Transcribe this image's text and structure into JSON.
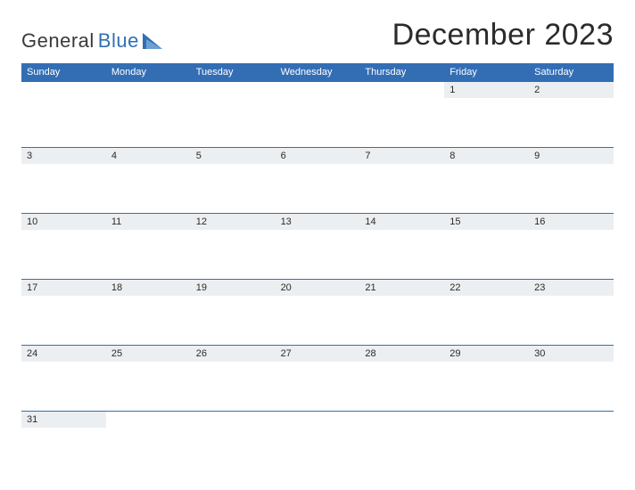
{
  "brand": {
    "part1": "General",
    "part2": "Blue"
  },
  "title": "December 2023",
  "day_names": [
    "Sunday",
    "Monday",
    "Tuesday",
    "Wednesday",
    "Thursday",
    "Friday",
    "Saturday"
  ],
  "weeks": [
    [
      "",
      "",
      "",
      "",
      "",
      "1",
      "2"
    ],
    [
      "3",
      "4",
      "5",
      "6",
      "7",
      "8",
      "9"
    ],
    [
      "10",
      "11",
      "12",
      "13",
      "14",
      "15",
      "16"
    ],
    [
      "17",
      "18",
      "19",
      "20",
      "21",
      "22",
      "23"
    ],
    [
      "24",
      "25",
      "26",
      "27",
      "28",
      "29",
      "30"
    ],
    [
      "31",
      "",
      "",
      "",
      "",
      "",
      ""
    ]
  ],
  "colors": {
    "accent": "#336eb5",
    "stripe": "#eceff2"
  }
}
